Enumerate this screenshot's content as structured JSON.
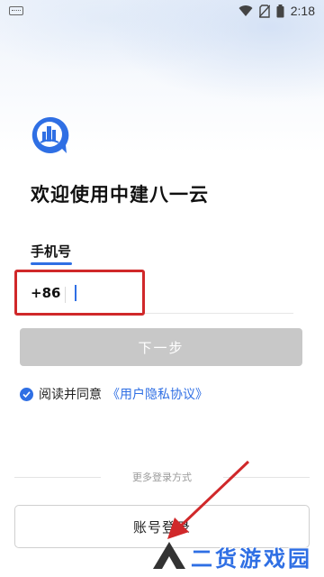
{
  "status_bar": {
    "time": "2:18",
    "icons": [
      "keyboard-icon",
      "wifi-icon",
      "no-sim-icon",
      "battery-icon"
    ]
  },
  "app": {
    "welcome_title": "欢迎使用中建八一云"
  },
  "login_form": {
    "tab_label": "手机号",
    "country_code": "+86",
    "phone_value": "",
    "phone_placeholder": "",
    "next_button_label": "下一步",
    "agree_text": "阅读并同意",
    "agreement_link": "《用户隐私协议》",
    "agree_checked": true
  },
  "more_login": {
    "label": "更多登录方式",
    "account_login_label": "账号登录"
  },
  "watermark": {
    "text": "二货游戏园"
  },
  "colors": {
    "accent": "#2f6fe4",
    "disabled_button": "#c8c8c8",
    "highlight_box": "#d0282a"
  }
}
